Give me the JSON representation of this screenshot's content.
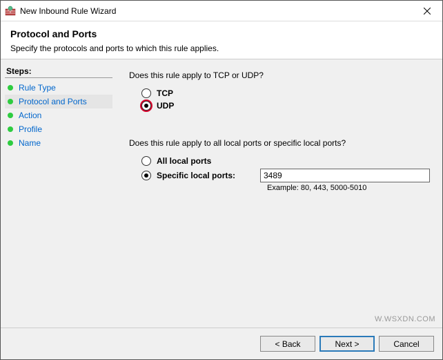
{
  "window": {
    "title": "New Inbound Rule Wizard"
  },
  "header": {
    "title": "Protocol and Ports",
    "subtitle": "Specify the protocols and ports to which this rule applies."
  },
  "steps": {
    "label": "Steps:",
    "items": [
      {
        "label": "Rule Type"
      },
      {
        "label": "Protocol and Ports"
      },
      {
        "label": "Action"
      },
      {
        "label": "Profile"
      },
      {
        "label": "Name"
      }
    ]
  },
  "content": {
    "q1": "Does this rule apply to TCP or UDP?",
    "tcp_label": "TCP",
    "udp_label": "UDP",
    "q2": "Does this rule apply to all local ports or specific local ports?",
    "all_ports_label": "All local ports",
    "specific_ports_label": "Specific local ports:",
    "port_value": "3489",
    "example": "Example: 80, 443, 5000-5010"
  },
  "footer": {
    "back": "< Back",
    "next": "Next >",
    "cancel": "Cancel"
  },
  "watermark": "W.WSXDN.COM"
}
